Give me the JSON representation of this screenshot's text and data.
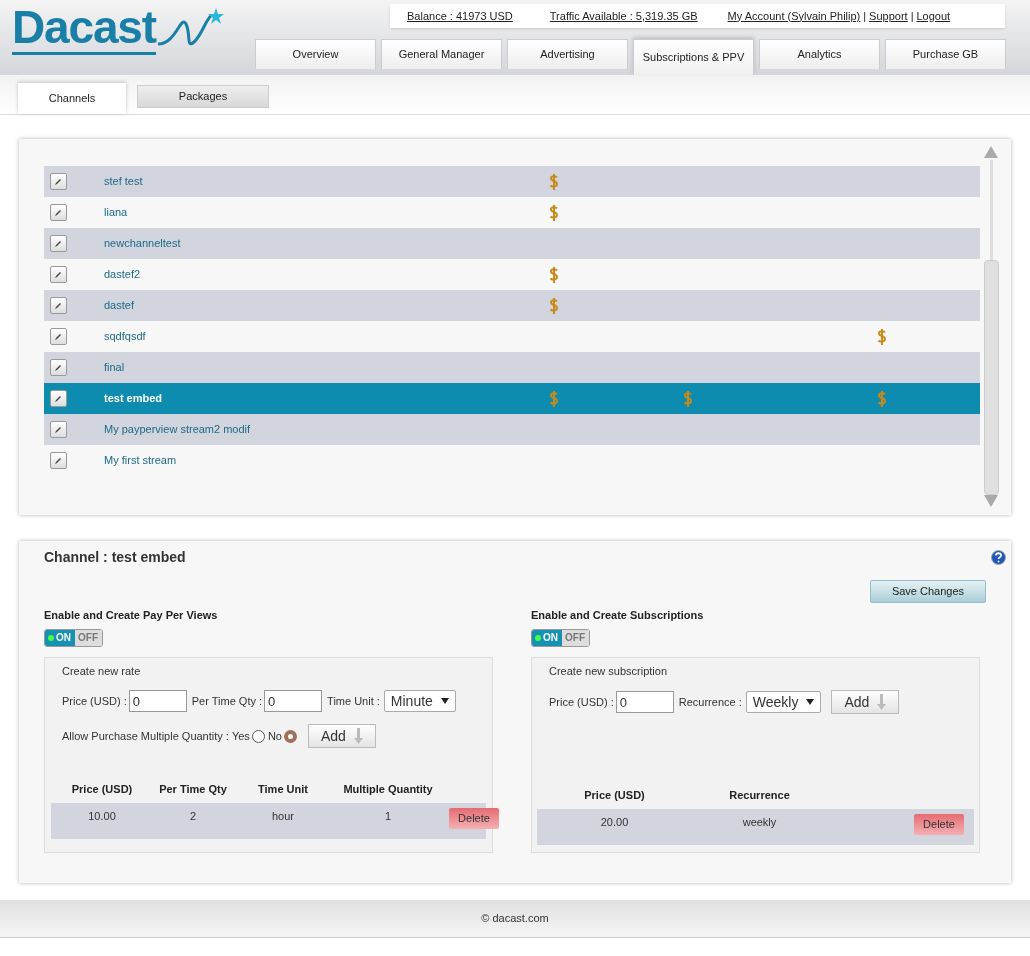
{
  "header": {
    "logo": "Dacast",
    "balance": "Balance : 41973 USD",
    "traffic": "Traffic Available : 5,319.35 GB",
    "account": "My Account (Sylvain Philip)",
    "separator_1": "|",
    "support": "Support",
    "separator_2": "|",
    "logout": "Logout"
  },
  "tabs": [
    {
      "label": "Overview",
      "selected": false
    },
    {
      "label": "General Manager",
      "selected": false
    },
    {
      "label": "Advertising",
      "selected": false
    },
    {
      "label": "Subscriptions & PPV",
      "selected": true
    },
    {
      "label": "Analytics",
      "selected": false
    },
    {
      "label": "Purchase GB",
      "selected": false
    }
  ],
  "subtabs": [
    {
      "label": "Channels",
      "selected": true
    },
    {
      "label": "Packages",
      "selected": false
    }
  ],
  "channels": [
    {
      "name": "stef test",
      "selected": false,
      "dollar_marks": [
        true,
        false,
        false
      ]
    },
    {
      "name": "liana",
      "selected": false,
      "dollar_marks": [
        true,
        false,
        false
      ]
    },
    {
      "name": "newchanneltest",
      "selected": false,
      "dollar_marks": [
        false,
        false,
        false
      ]
    },
    {
      "name": "dastef2",
      "selected": false,
      "dollar_marks": [
        true,
        false,
        false
      ]
    },
    {
      "name": "dastef",
      "selected": false,
      "dollar_marks": [
        true,
        false,
        false
      ]
    },
    {
      "name": "sqdfqsdf",
      "selected": false,
      "dollar_marks": [
        false,
        false,
        true
      ]
    },
    {
      "name": "final",
      "selected": false,
      "dollar_marks": [
        false,
        false,
        false
      ]
    },
    {
      "name": "test embed",
      "selected": true,
      "dollar_marks": [
        true,
        true,
        true
      ]
    },
    {
      "name": "My payperview stream2 modif",
      "selected": false,
      "dollar_marks": [
        false,
        false,
        false
      ]
    },
    {
      "name": "My first stream",
      "selected": false,
      "dollar_marks": [
        false,
        false,
        false
      ]
    }
  ],
  "detail": {
    "title": "Channel : test embed",
    "save_button": "Save Changes",
    "ppv": {
      "heading": "Enable and Create Pay Per Views",
      "toggle": {
        "on_label": "ON",
        "off_label": "OFF",
        "on": true
      },
      "box_title": "Create new rate",
      "price_label": "Price (USD) :",
      "price_value": "0",
      "qty_label": "Per Time Qty :",
      "qty_value": "0",
      "unit_label": "Time Unit :",
      "unit_value": "Minute",
      "multiple_label": "Allow Purchase Multiple Quantity :",
      "radios": [
        {
          "label": "Yes",
          "selected": false
        },
        {
          "label": "No",
          "selected": true
        }
      ],
      "add_button": "Add",
      "columns": [
        "Price (USD)",
        "Per Time Qty",
        "Time Unit",
        "Multiple Quantity"
      ],
      "rows": [
        {
          "cells": [
            "10.00",
            "2",
            "hour",
            "1"
          ],
          "delete": "Delete"
        }
      ]
    },
    "subscriptions": {
      "heading": "Enable and Create Subscriptions",
      "toggle": {
        "on_label": "ON",
        "off_label": "OFF",
        "on": true
      },
      "box_title": "Create new subscription",
      "price_label": "Price (USD) :",
      "price_value": "0",
      "recurrence_label": "Recurrence :",
      "recurrence_value": "Weekly",
      "add_button": "Add",
      "columns": [
        "Price (USD)",
        "Recurrence"
      ],
      "rows": [
        {
          "cells": [
            "20.00",
            "weekly"
          ],
          "delete": "Delete"
        }
      ]
    }
  },
  "footer": "© dacast.com"
}
